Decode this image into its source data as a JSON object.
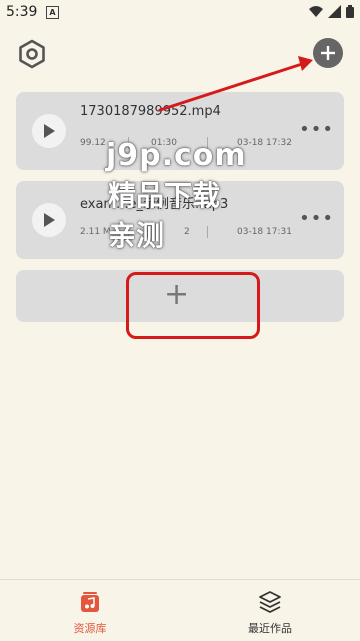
{
  "status_bar": {
    "time": "5:39",
    "indicator": "A",
    "icons": [
      "wifi-icon",
      "signal-icon",
      "battery-icon"
    ]
  },
  "top_bar": {
    "settings_icon": "gear-hex-icon",
    "add_icon": "plus-circle-icon"
  },
  "items": [
    {
      "title": "1730187989952.mp4",
      "size": "99.12",
      "duration": "01:30",
      "date": "03-18 17:32"
    },
    {
      "title": "exam...e_示例音乐.mp3",
      "size": "2.11 M",
      "duration": "2",
      "date": "03-18 17:31"
    }
  ],
  "more_label": "•••",
  "add_card_label": "+",
  "watermark": {
    "line1": "j9p.com",
    "line2": "精品下载",
    "line3": "亲测"
  },
  "bottom_nav": [
    {
      "label": "资源库",
      "icon": "music-folder-icon",
      "active": true
    },
    {
      "label": "最近作品",
      "icon": "layers-icon",
      "active": false
    }
  ],
  "colors": {
    "accent": "#e2573e",
    "background": "#f8f4e8",
    "card": "#dcdcdc",
    "annotation": "#d61a1a"
  }
}
